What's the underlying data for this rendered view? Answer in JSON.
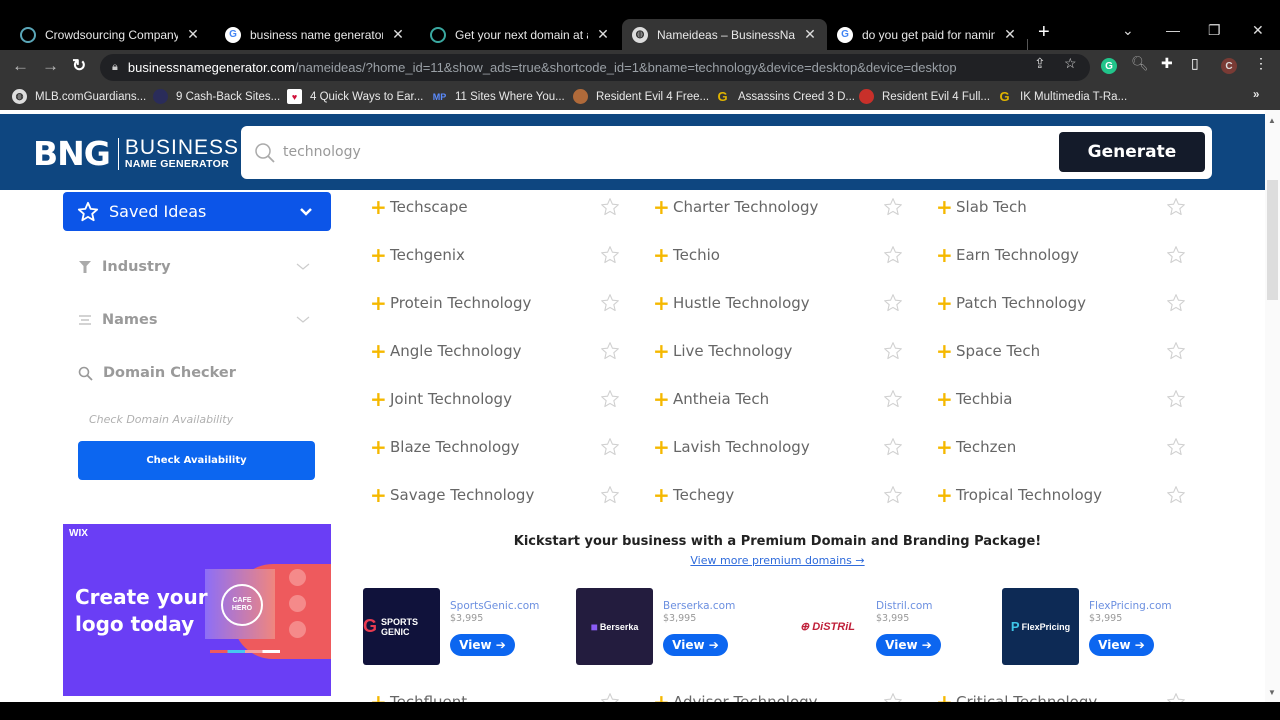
{
  "browser": {
    "tabs": [
      {
        "title": "Crowdsourcing Company Na",
        "icon": "crowdsourcing-favicon",
        "active": false
      },
      {
        "title": "business name generator - G",
        "icon": "google-favicon",
        "active": false
      },
      {
        "title": "Get your next domain at a gr",
        "icon": "domain-favicon",
        "active": false
      },
      {
        "title": "Nameideas – BusinessName",
        "icon": "globe-favicon",
        "active": true
      },
      {
        "title": "do you get paid for naming a",
        "icon": "google-favicon",
        "active": false
      }
    ],
    "close_glyph": "✕",
    "new_tab_glyph": "+",
    "url_host": "businessnamegenerator.com",
    "url_path": "/nameideas/?home_id=11&show_ads=true&shortcode_id=1&bname=technology&device=desktop&device=desktop",
    "profile_initial": "C",
    "extension_initial": "G",
    "bookmarks": [
      {
        "label": "MLB.comGuardians...",
        "icon": "globe-icon"
      },
      {
        "label": "9 Cash-Back Sites...",
        "icon": "circle-icon"
      },
      {
        "label": "4 Quick Ways to Ear...",
        "icon": "heart-icon"
      },
      {
        "label": "11 Sites Where You...",
        "icon": "mp-icon",
        "badge": "MP"
      },
      {
        "label": "Resident Evil 4 Free...",
        "icon": "cookie-icon"
      },
      {
        "label": "Assassins Creed 3 D...",
        "icon": "g-icon",
        "badge": "G"
      },
      {
        "label": "Resident Evil 4 Full...",
        "icon": "umbrella-icon"
      },
      {
        "label": "IK Multimedia T-Ra...",
        "icon": "g-icon",
        "badge": "G"
      }
    ],
    "bookmarks_overflow": "»"
  },
  "header": {
    "logo_mark": "BNG",
    "logo_word1": "BUSINESS",
    "logo_word2": "NAME GENERATOR",
    "search_value": "technology",
    "generate_label": "Generate"
  },
  "sidebar": {
    "saved_ideas_label": "Saved Ideas",
    "items": [
      {
        "label": "Industry",
        "icon": "filter-icon"
      },
      {
        "label": "Names",
        "icon": "list-icon"
      },
      {
        "label": "Domain Checker",
        "icon": "search-icon"
      }
    ],
    "domain_hint": "Check Domain Availability",
    "check_button": "Check Availability",
    "ad": {
      "brand": "WIX",
      "headline_line1": "Create your",
      "headline_line2": "logo today",
      "seal_text": "CAFE HERO"
    }
  },
  "names": {
    "columns": [
      [
        "Techscape",
        "Techgenix",
        "Protein Technology",
        "Angle Technology",
        "Joint Technology",
        "Blaze Technology",
        "Savage Technology"
      ],
      [
        "Charter Technology",
        "Techio",
        "Hustle Technology",
        "Live Technology",
        "Antheia Tech",
        "Lavish Technology",
        "Techegy"
      ],
      [
        "Slab Tech",
        "Earn Technology",
        "Patch Technology",
        "Space Tech",
        "Techbia",
        "Techzen",
        "Tropical Technology"
      ]
    ],
    "partial_row": [
      "Techfluent",
      "Advisor Technology",
      "Critical Technology"
    ],
    "plus_glyph": "+"
  },
  "premium": {
    "title": "Kickstart your business with a Premium Domain and Branding Package!",
    "link": "View more premium domains →",
    "domains": [
      {
        "name": "SportsGenic.com",
        "price": "$3,995",
        "logo_text": "SPORTS GENIC",
        "logo_bg": "#10123b",
        "view": "View ➔"
      },
      {
        "name": "Berserka.com",
        "price": "$3,995",
        "logo_text": "Berserka",
        "logo_bg": "#231c3e",
        "view": "View ➔"
      },
      {
        "name": "Distril.com",
        "price": "$3,995",
        "logo_text": "DiSTRiL",
        "logo_bg": "#ffffff",
        "view": "View ➔"
      },
      {
        "name": "FlexPricing.com",
        "price": "$3,995",
        "logo_text": "FlexPricing",
        "logo_bg": "#0d2a55",
        "view": "View ➔"
      }
    ]
  },
  "colors": {
    "header_bg": "#0e4680",
    "accent_blue": "#0c55e8",
    "plus_yellow": "#f5b800",
    "generate_bg": "#141b2a"
  }
}
